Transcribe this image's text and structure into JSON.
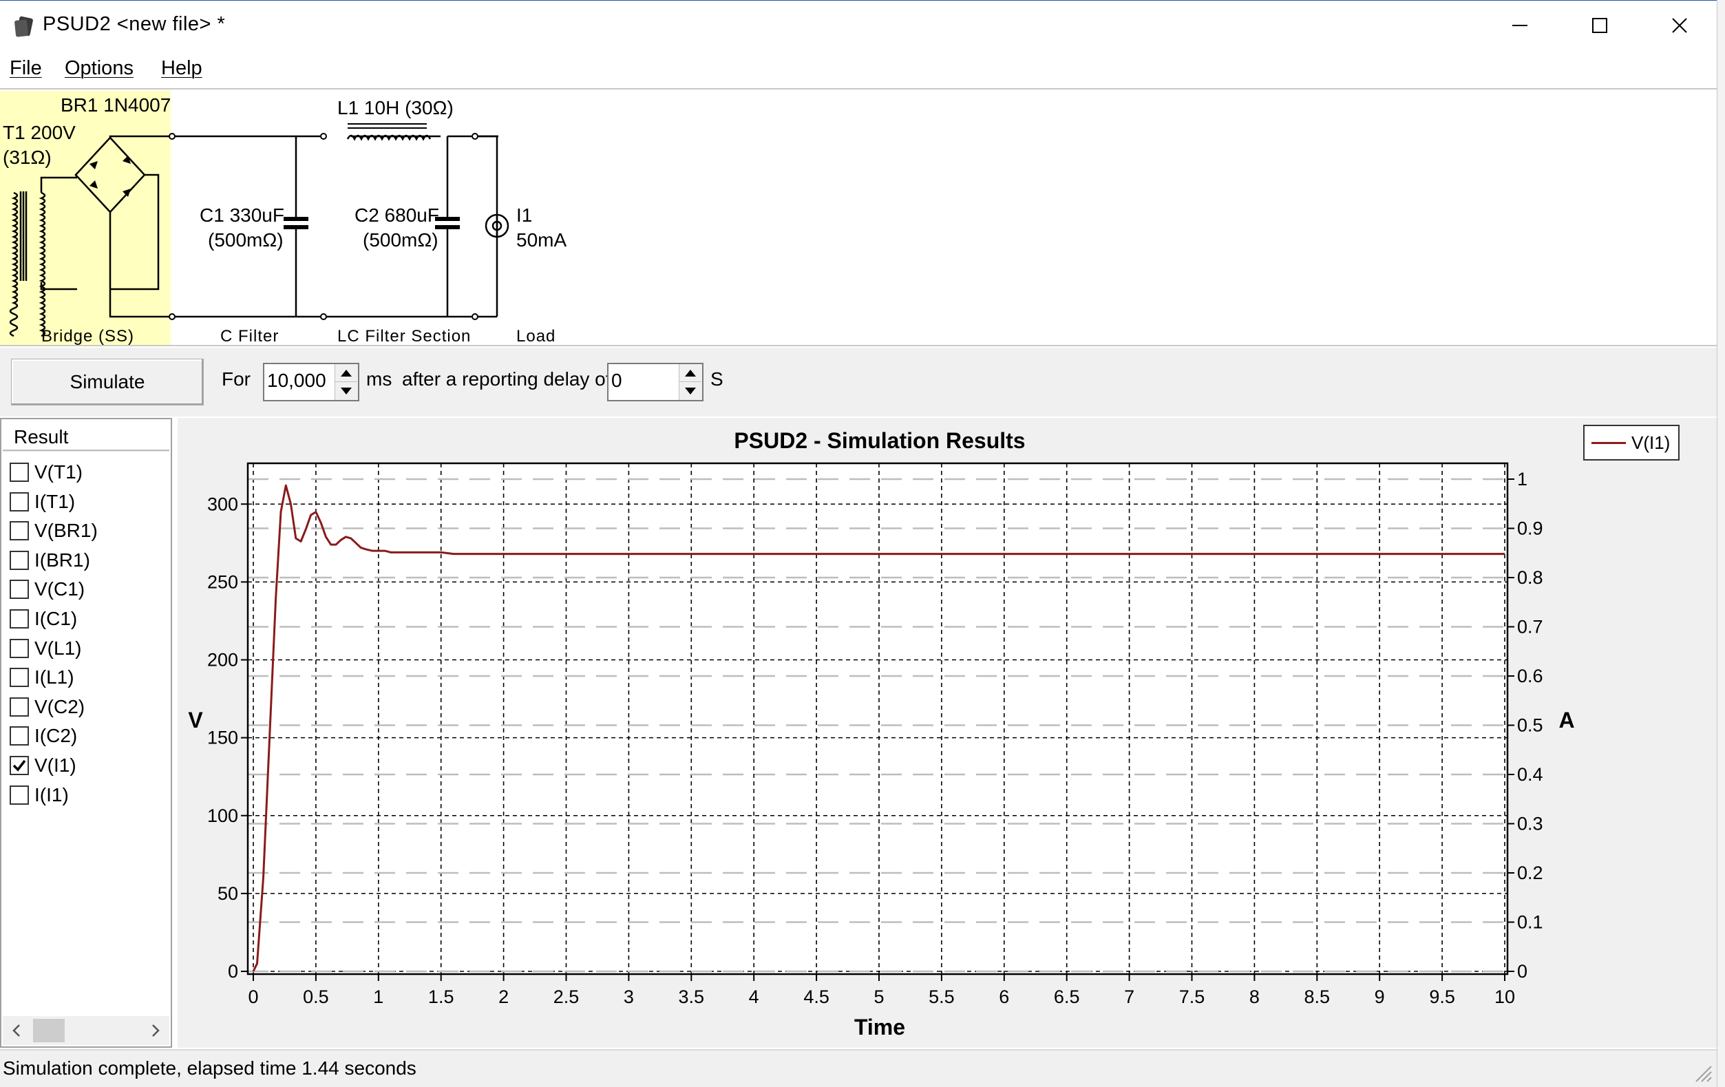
{
  "window": {
    "title": "PSUD2  <new file> *",
    "app_icon": "psud-app-icon",
    "controls": [
      "minimize-icon",
      "maximize-icon",
      "close-icon"
    ]
  },
  "menu": {
    "items": [
      "File",
      "Options",
      "Help"
    ]
  },
  "schematic": {
    "bridge_label": "BR1 1N4007",
    "transformer_label": "T1 200V",
    "transformer_resistance": "(31Ω)",
    "inductor_label": "L1 10H (30Ω)",
    "c1_label": "C1 330uF",
    "c1_esr": "(500mΩ)",
    "c2_label": "C2 680uF",
    "c2_esr": "(500mΩ)",
    "load_name": "I1",
    "load_value": "50mA",
    "sections": [
      "Bridge (SS)",
      "C Filter",
      "LC Filter Section",
      "Load"
    ],
    "bridge_highlight_color": "#ffffc0"
  },
  "toolbar": {
    "simulate_label": "Simulate",
    "for_label": "For",
    "duration_value": "10,000",
    "ms_label": "ms",
    "delay_label": "after a reporting delay of",
    "delay_value": "0",
    "s_label": "S"
  },
  "results": {
    "header": "Result",
    "items": [
      {
        "label": "V(T1)",
        "checked": false
      },
      {
        "label": "I(T1)",
        "checked": false
      },
      {
        "label": "V(BR1)",
        "checked": false
      },
      {
        "label": "I(BR1)",
        "checked": false
      },
      {
        "label": "V(C1)",
        "checked": false
      },
      {
        "label": "I(C1)",
        "checked": false
      },
      {
        "label": "V(L1)",
        "checked": false
      },
      {
        "label": "I(L1)",
        "checked": false
      },
      {
        "label": "V(C2)",
        "checked": false
      },
      {
        "label": "I(C2)",
        "checked": false
      },
      {
        "label": "V(I1)",
        "checked": true
      },
      {
        "label": "I(I1)",
        "checked": false
      }
    ]
  },
  "chart_data": {
    "type": "line",
    "title": "PSUD2 - Simulation Results",
    "xlabel": "Time",
    "ylabel": "V",
    "y2label": "A",
    "xlim": [
      0,
      10
    ],
    "ylim": [
      0,
      320
    ],
    "y2lim": [
      0,
      1
    ],
    "xticks": [
      "0",
      "0.5",
      "1",
      "1.5",
      "2",
      "2.5",
      "3",
      "3.5",
      "4",
      "4.5",
      "5",
      "5.5",
      "6",
      "6.5",
      "7",
      "7.5",
      "8",
      "8.5",
      "9",
      "9.5",
      "10"
    ],
    "yticks": [
      "0",
      "50",
      "100",
      "150",
      "200",
      "250",
      "300"
    ],
    "y2ticks": [
      "0",
      "0.1",
      "0.2",
      "0.3",
      "0.4",
      "0.5",
      "0.6",
      "0.7",
      "0.8",
      "0.9",
      "1"
    ],
    "grid": true,
    "legend": "top-right",
    "series": [
      {
        "name": "V(I1)",
        "color": "#8b1a1a",
        "x": [
          0,
          0.03,
          0.08,
          0.13,
          0.18,
          0.22,
          0.26,
          0.3,
          0.34,
          0.38,
          0.42,
          0.46,
          0.5,
          0.54,
          0.58,
          0.62,
          0.66,
          0.7,
          0.74,
          0.78,
          0.82,
          0.86,
          0.9,
          0.95,
          1.0,
          1.05,
          1.1,
          1.2,
          1.3,
          1.4,
          1.5,
          1.6,
          2,
          3,
          4,
          5,
          6,
          7,
          8,
          9,
          10
        ],
        "y": [
          0,
          5,
          60,
          150,
          240,
          295,
          312,
          300,
          278,
          276,
          284,
          293,
          295,
          288,
          279,
          274,
          274,
          277,
          279,
          278,
          275,
          272,
          271,
          270,
          270,
          270,
          269,
          269,
          269,
          269,
          269,
          268,
          268,
          268,
          268,
          268,
          268,
          268,
          268,
          268,
          268
        ]
      }
    ]
  },
  "status": {
    "text": "Simulation complete, elapsed time 1.44 seconds"
  }
}
